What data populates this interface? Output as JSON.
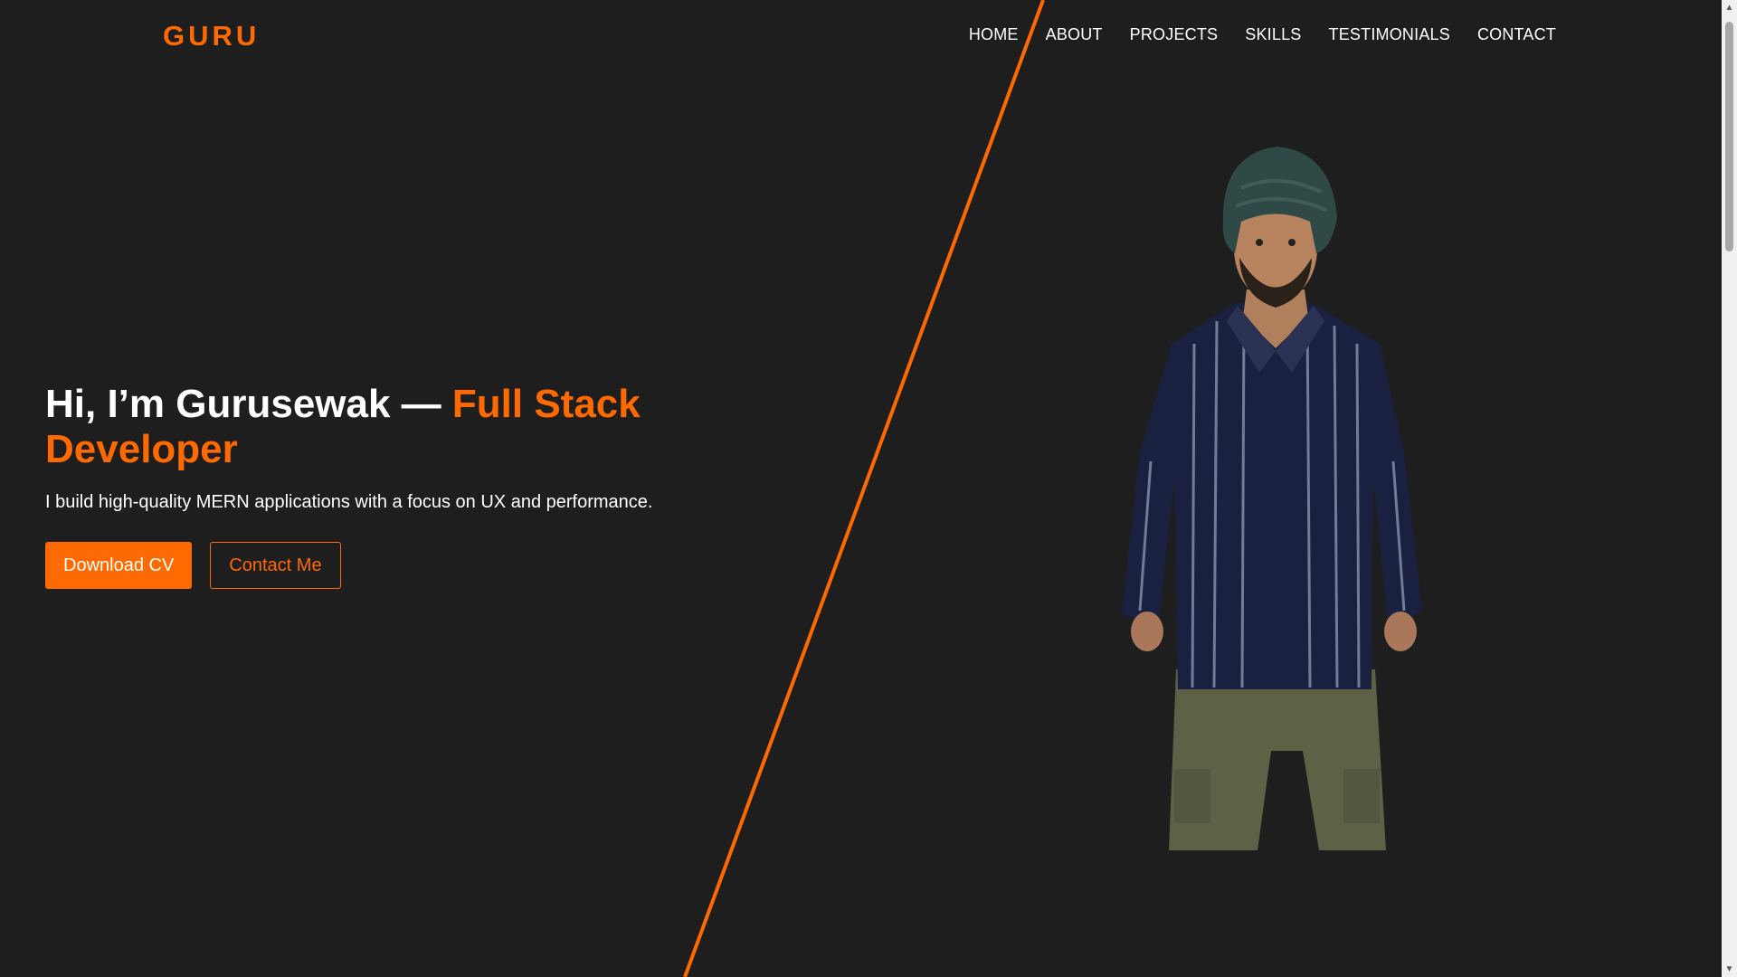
{
  "header": {
    "logo": "GURU",
    "nav": [
      {
        "label": "HOME"
      },
      {
        "label": "ABOUT"
      },
      {
        "label": "PROJECTS"
      },
      {
        "label": "SKILLS"
      },
      {
        "label": "TESTIMONIALS"
      },
      {
        "label": "CONTACT"
      }
    ]
  },
  "hero": {
    "heading_prefix": "Hi, I’m Gurusewak — ",
    "heading_accent": "Full Stack Developer",
    "subtitle": "I build high-quality MERN applications with a focus on UX and performance.",
    "primary_button": "Download CV",
    "secondary_button": "Contact Me"
  },
  "theme": {
    "background": "#1e1e1e",
    "accent": "#ff6a00",
    "text": "#ffffff"
  },
  "icons": {
    "scroll_up": "triangle-up-icon",
    "scroll_down": "triangle-down-icon"
  }
}
